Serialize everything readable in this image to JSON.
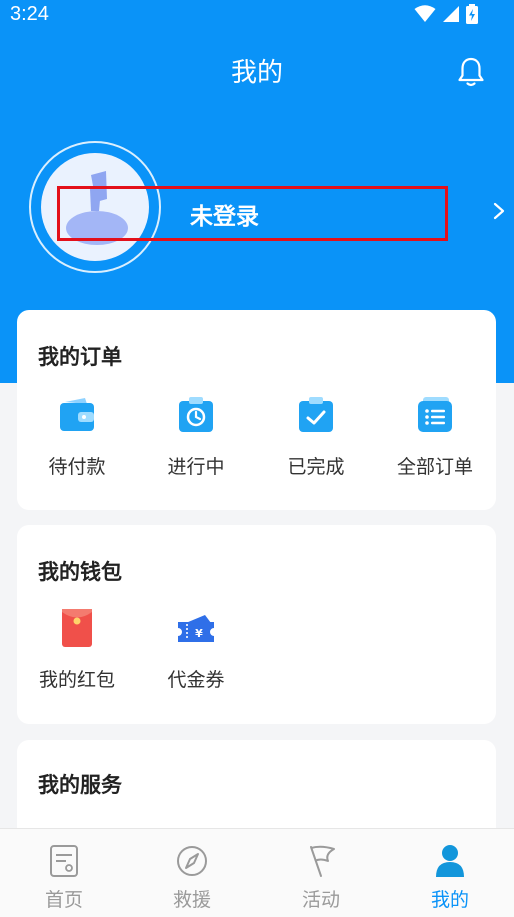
{
  "status_bar": {
    "time": "3:24",
    "icons": [
      "wifi-icon",
      "signal-icon",
      "battery-icon"
    ]
  },
  "header": {
    "title": "我的",
    "bell_icon": "bell-icon"
  },
  "profile": {
    "name": "未登录",
    "avatar_icon": "default-avatar-icon"
  },
  "orders": {
    "title": "我的订单",
    "items": [
      {
        "label": "待付款",
        "icon": "wallet-icon"
      },
      {
        "label": "进行中",
        "icon": "clock-clipboard-icon"
      },
      {
        "label": "已完成",
        "icon": "check-clipboard-icon"
      },
      {
        "label": "全部订单",
        "icon": "list-icon"
      }
    ]
  },
  "wallet": {
    "title": "我的钱包",
    "items": [
      {
        "label": "我的红包",
        "icon": "red-envelope-icon"
      },
      {
        "label": "代金券",
        "icon": "voucher-icon"
      }
    ]
  },
  "services": {
    "title": "我的服务"
  },
  "tabbar": {
    "tabs": [
      {
        "label": "首页",
        "icon": "home-document-icon",
        "active": false
      },
      {
        "label": "救援",
        "icon": "compass-icon",
        "active": false
      },
      {
        "label": "活动",
        "icon": "flag-icon",
        "active": false
      },
      {
        "label": "我的",
        "icon": "user-icon",
        "active": true
      }
    ]
  },
  "colors": {
    "primary": "#0a93f8",
    "highlight": "#e3101a",
    "red_envelope": "#f0504a"
  }
}
